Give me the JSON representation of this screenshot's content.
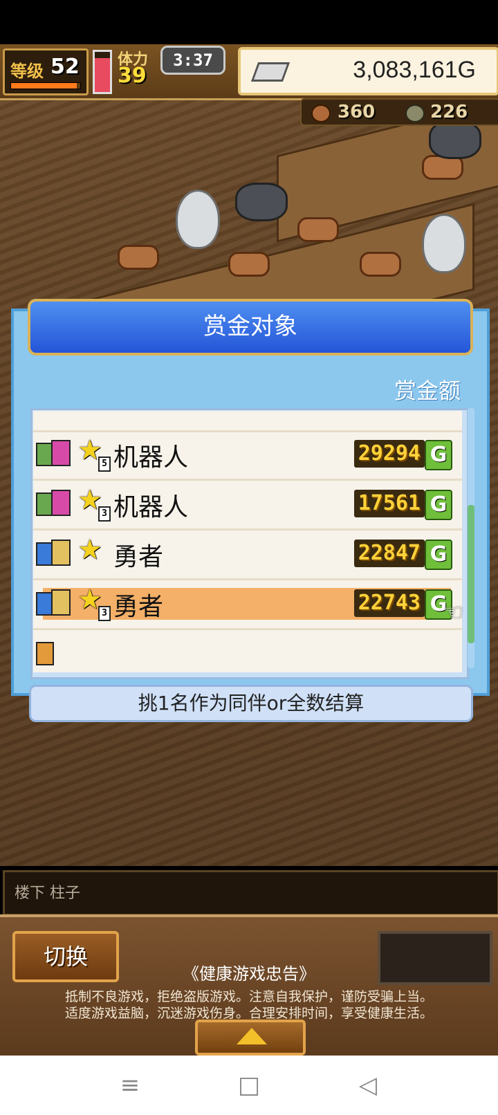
{
  "hud": {
    "level_label": "等级",
    "level_value": "52",
    "level_progress": 0.95,
    "stamina_label": "体力",
    "stamina_value": "39",
    "stamina_fill": 0.85,
    "clock": "3:37",
    "gold": "3,083,161G",
    "resource_1": "360",
    "resource_2": "226"
  },
  "dialog": {
    "title": "赏金对象",
    "column_header": "赏金额",
    "rows": [
      {
        "name": "机器人",
        "rank": "5",
        "amount": "29294",
        "currency": "G",
        "selected": false
      },
      {
        "name": "机器人",
        "rank": "3",
        "amount": "17561",
        "currency": "G",
        "selected": false
      },
      {
        "name": "勇者",
        "rank": "",
        "amount": "22847",
        "currency": "G",
        "selected": false
      },
      {
        "name": "勇者",
        "rank": "3",
        "amount": "22743",
        "currency": "G",
        "selected": true
      }
    ],
    "footer": "挑1名作为同伴or全数结算"
  },
  "message_bar": {
    "text": "楼下 柱子"
  },
  "bottom": {
    "switch_label": "切换",
    "notice_title": "《健康游戏忠告》",
    "notice_line1": "抵制不良游戏，拒绝盗版游戏。注意自我保护，谨防受骗上当。",
    "notice_line2": "适度游戏益脑，沉迷游戏伤身。合理安排时间，享受健康生活。"
  },
  "nav": {
    "menu_icon": "≡",
    "home_icon": "□",
    "back_icon": "◁"
  },
  "colors": {
    "accent_blue": "#2455d8",
    "gold_text": "#ffd23a",
    "selected_row": "#f4b068"
  }
}
